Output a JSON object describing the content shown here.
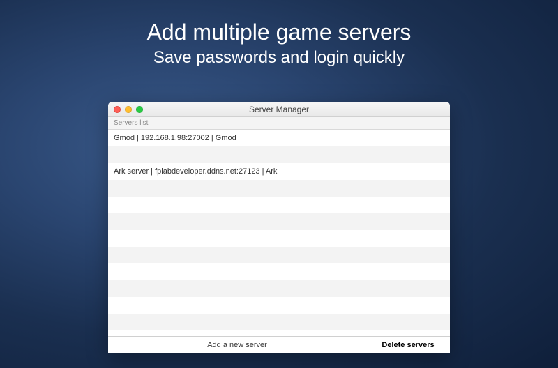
{
  "promo": {
    "title": "Add multiple game servers",
    "subtitle": "Save passwords and login quickly"
  },
  "window": {
    "title": "Server Manager",
    "list_header": "Servers list",
    "servers": [
      "Gmod | 192.168.1.98:27002 | Gmod",
      "Ark server | fplabdeveloper.ddns.net:27123 | Ark"
    ],
    "toolbar": {
      "add_label": "Add a new server",
      "delete_label": "Delete servers"
    }
  }
}
